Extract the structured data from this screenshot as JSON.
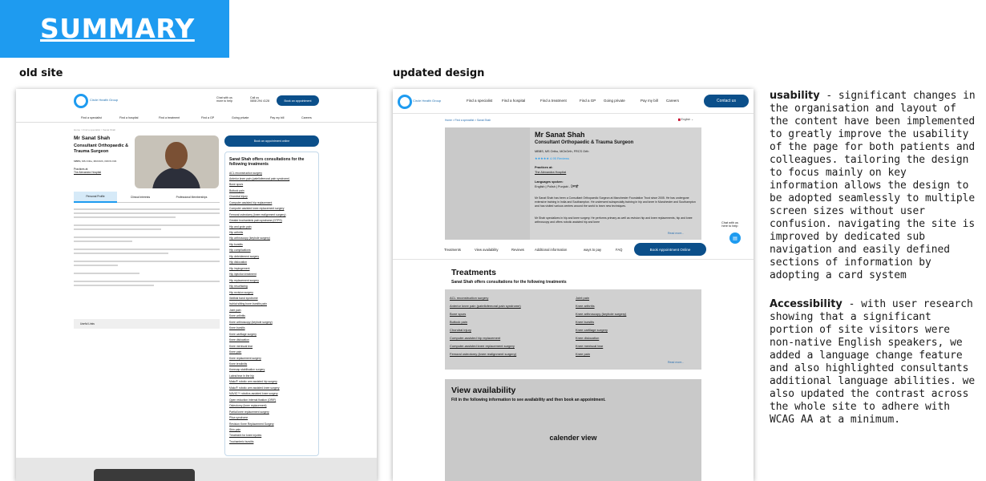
{
  "banner": {
    "title": "SUMMARY"
  },
  "labels": {
    "old": "old site",
    "new": "updated design"
  },
  "old_site": {
    "logo_text": "Circle Health Group",
    "chat": "Chat with us\nmore to help",
    "call": "Call us\n0808 294 4128",
    "book_header": "Book an appointment",
    "nav": [
      "Find a specialist",
      "Find a hospital",
      "Find a treatment",
      "Find a GP",
      "Going private",
      "Pay my bill",
      "Careers"
    ],
    "crumbs": "Home  >  Find a specialist  >  Sanat Shah",
    "name": "Mr Sanat Shah",
    "role": "Consultant Orthopaedic & Trauma Surgeon",
    "quals": "MBBS, MS Ortho, MChOrth, FRCS Orth",
    "practice_label": "Practices at:",
    "practice": "The Alexandra Hospital",
    "tabs": [
      "Personal Profile",
      "Clinical Interests",
      "Professional Memberships"
    ],
    "useful": "Useful Links",
    "book": "Book an appointment online",
    "panel_title": "Sanat Shah offers consultations for the following treatments",
    "panel_items": [
      "ACL reconstruction surgery",
      "Anterior knee pain (patellofemoral pain syndrome)",
      "Bone spurs",
      "Buttock pain",
      "Chondral injury",
      "Computer assisted hip replacement",
      "Computer assisted knee replacement surgery",
      "Femoral osteotomy (knee realignment surgery)",
      "Greater trochanteric pain syndrome (GTPS)",
      "Hip and groin pain",
      "Hip arthritis",
      "Hip arthroscopy (keyhole surgery)",
      "Hip bursitis",
      "Hip complications",
      "Hip debridement surgery",
      "Hip dislocation",
      "Hip impingement",
      "Hip injection treatment",
      "Hip replacement surgery",
      "Hip resurfacing",
      "Hip revision surgery",
      "Iliotibial band syndrome",
      "Ischial sitting bone bursitis pain",
      "Joint pain",
      "Knee arthritis",
      "Knee arthroscopy (keyhole surgery)",
      "Knee bursitis",
      "Knee cartilage surgery",
      "Knee dislocation",
      "Knee meniscal tear",
      "Knee pain",
      "Knee replacement surgery",
      "Knee tendinitis",
      "Kneecap stabilisation surgery",
      "Labral tear in the hip",
      "Mako® robotic arm assisted hip surgery",
      "Mako® robotic arm assisted knee surgery",
      "NAVIO™ robotics-assisted knee surgery",
      "Open reduction internal fixation (ORIF)",
      "Osteotomy (knee replacement)",
      "Partial knee replacement surgery",
      "Plica syndrome",
      "Revision Knee Replacement Surgery",
      "Shin pain",
      "Treatment for knee injuries",
      "Trochanteric bursitis"
    ]
  },
  "new_site": {
    "logo_text": "Circle Health Group",
    "nav": [
      "Find a specialist",
      "Find a hospital",
      "Find a treatment",
      "Find a GP",
      "Going private",
      "Pay my bill",
      "Careers"
    ],
    "contact": "Contact us",
    "crumbs": "Home  >  Find a specialist  >  Sanat Shah",
    "lang": "English",
    "name": "Mr Sanat Shah",
    "role": "Consultant Orthopaedic & Trauma Surgeon",
    "quals": "MBBS, MS Ortho, MChOrth, FRCS Orth",
    "stars": "★★★★★  4.95  Reviews",
    "practice_label": "Practices at:",
    "practice": "The Alexandra Hospital",
    "lang_label": "Languages spoken:",
    "langs": "English  |  Polish  |  Punjabi  - ਪੰਜਾਬੀ",
    "bio1": "Mr Sanat Shah has been a Consultant Orthopaedic Surgeon at Manchester Foundation Trust since 2005. He has undergone extensive training in India and Southampton. He underwent subspecialty training in hip and knee in Manchester and Southampton and has visited various centres around the world to learn new techniques.",
    "bio2": "Mr Shah specializes in hip and knee surgery. He performs primary as well as revision hip and knee replacements, hip and knee arthroscopy and offers robotic assisted hip and knee",
    "read_more": "Read more...",
    "chat_label": "Chat with us\nhere to help",
    "subnav": [
      "Treatments",
      "View availability",
      "Reviews",
      "Additional information",
      "ways to pay",
      "FAQ"
    ],
    "book": "Book Appointment Online",
    "treatments_title": "Treatments",
    "treatments_sub": "Sanat Shah offers consultations for the following treatments",
    "treat_col1": [
      "ACL reconstruction surgery",
      "Anterior knee pain (patellofemoral pain syndrome)",
      "Bone spurs",
      "Buttock pain",
      "Chondral injury",
      "Computer-assisted hip replacement",
      "Computer-assisted knee replacement surgery",
      "Femoral osteotomy (knee realignment surgery)"
    ],
    "treat_col2": [
      "Joint pain",
      "Knee arthritis",
      "Knee arthroscopy (keyhole surgery)",
      "Knee bursitis",
      "Knee cartilage surgery",
      "Knee dislocation",
      "Knee meniscal tear",
      "Knee pain"
    ],
    "avail_title": "View availability",
    "avail_sub": "Fill in the following information to see availability and then book an appointment.",
    "calendar": "calender view"
  },
  "notes": {
    "usability_title": "usability",
    "usability_text": " - significant changes in the organisation and layout of the content have been implemented to greatly improve the usability of the page for both patients and colleagues. tailoring the design to focus mainly on key information allows the design to be adopted seamlessly to multiple screen sizes without user confusion. navigating the site is improved by dedicated sub navigation and easily defined sections of information by adopting a card system",
    "accessibility_title": "Accessibility",
    "accessibility_text": " - with user research showing that a significant portion of site visitors were non-native English speakers, we added a language change feature and also highlighted consultants additional language abilities. we also updated the contrast across the whole site to adhere with WCAG AA at a minimum."
  }
}
